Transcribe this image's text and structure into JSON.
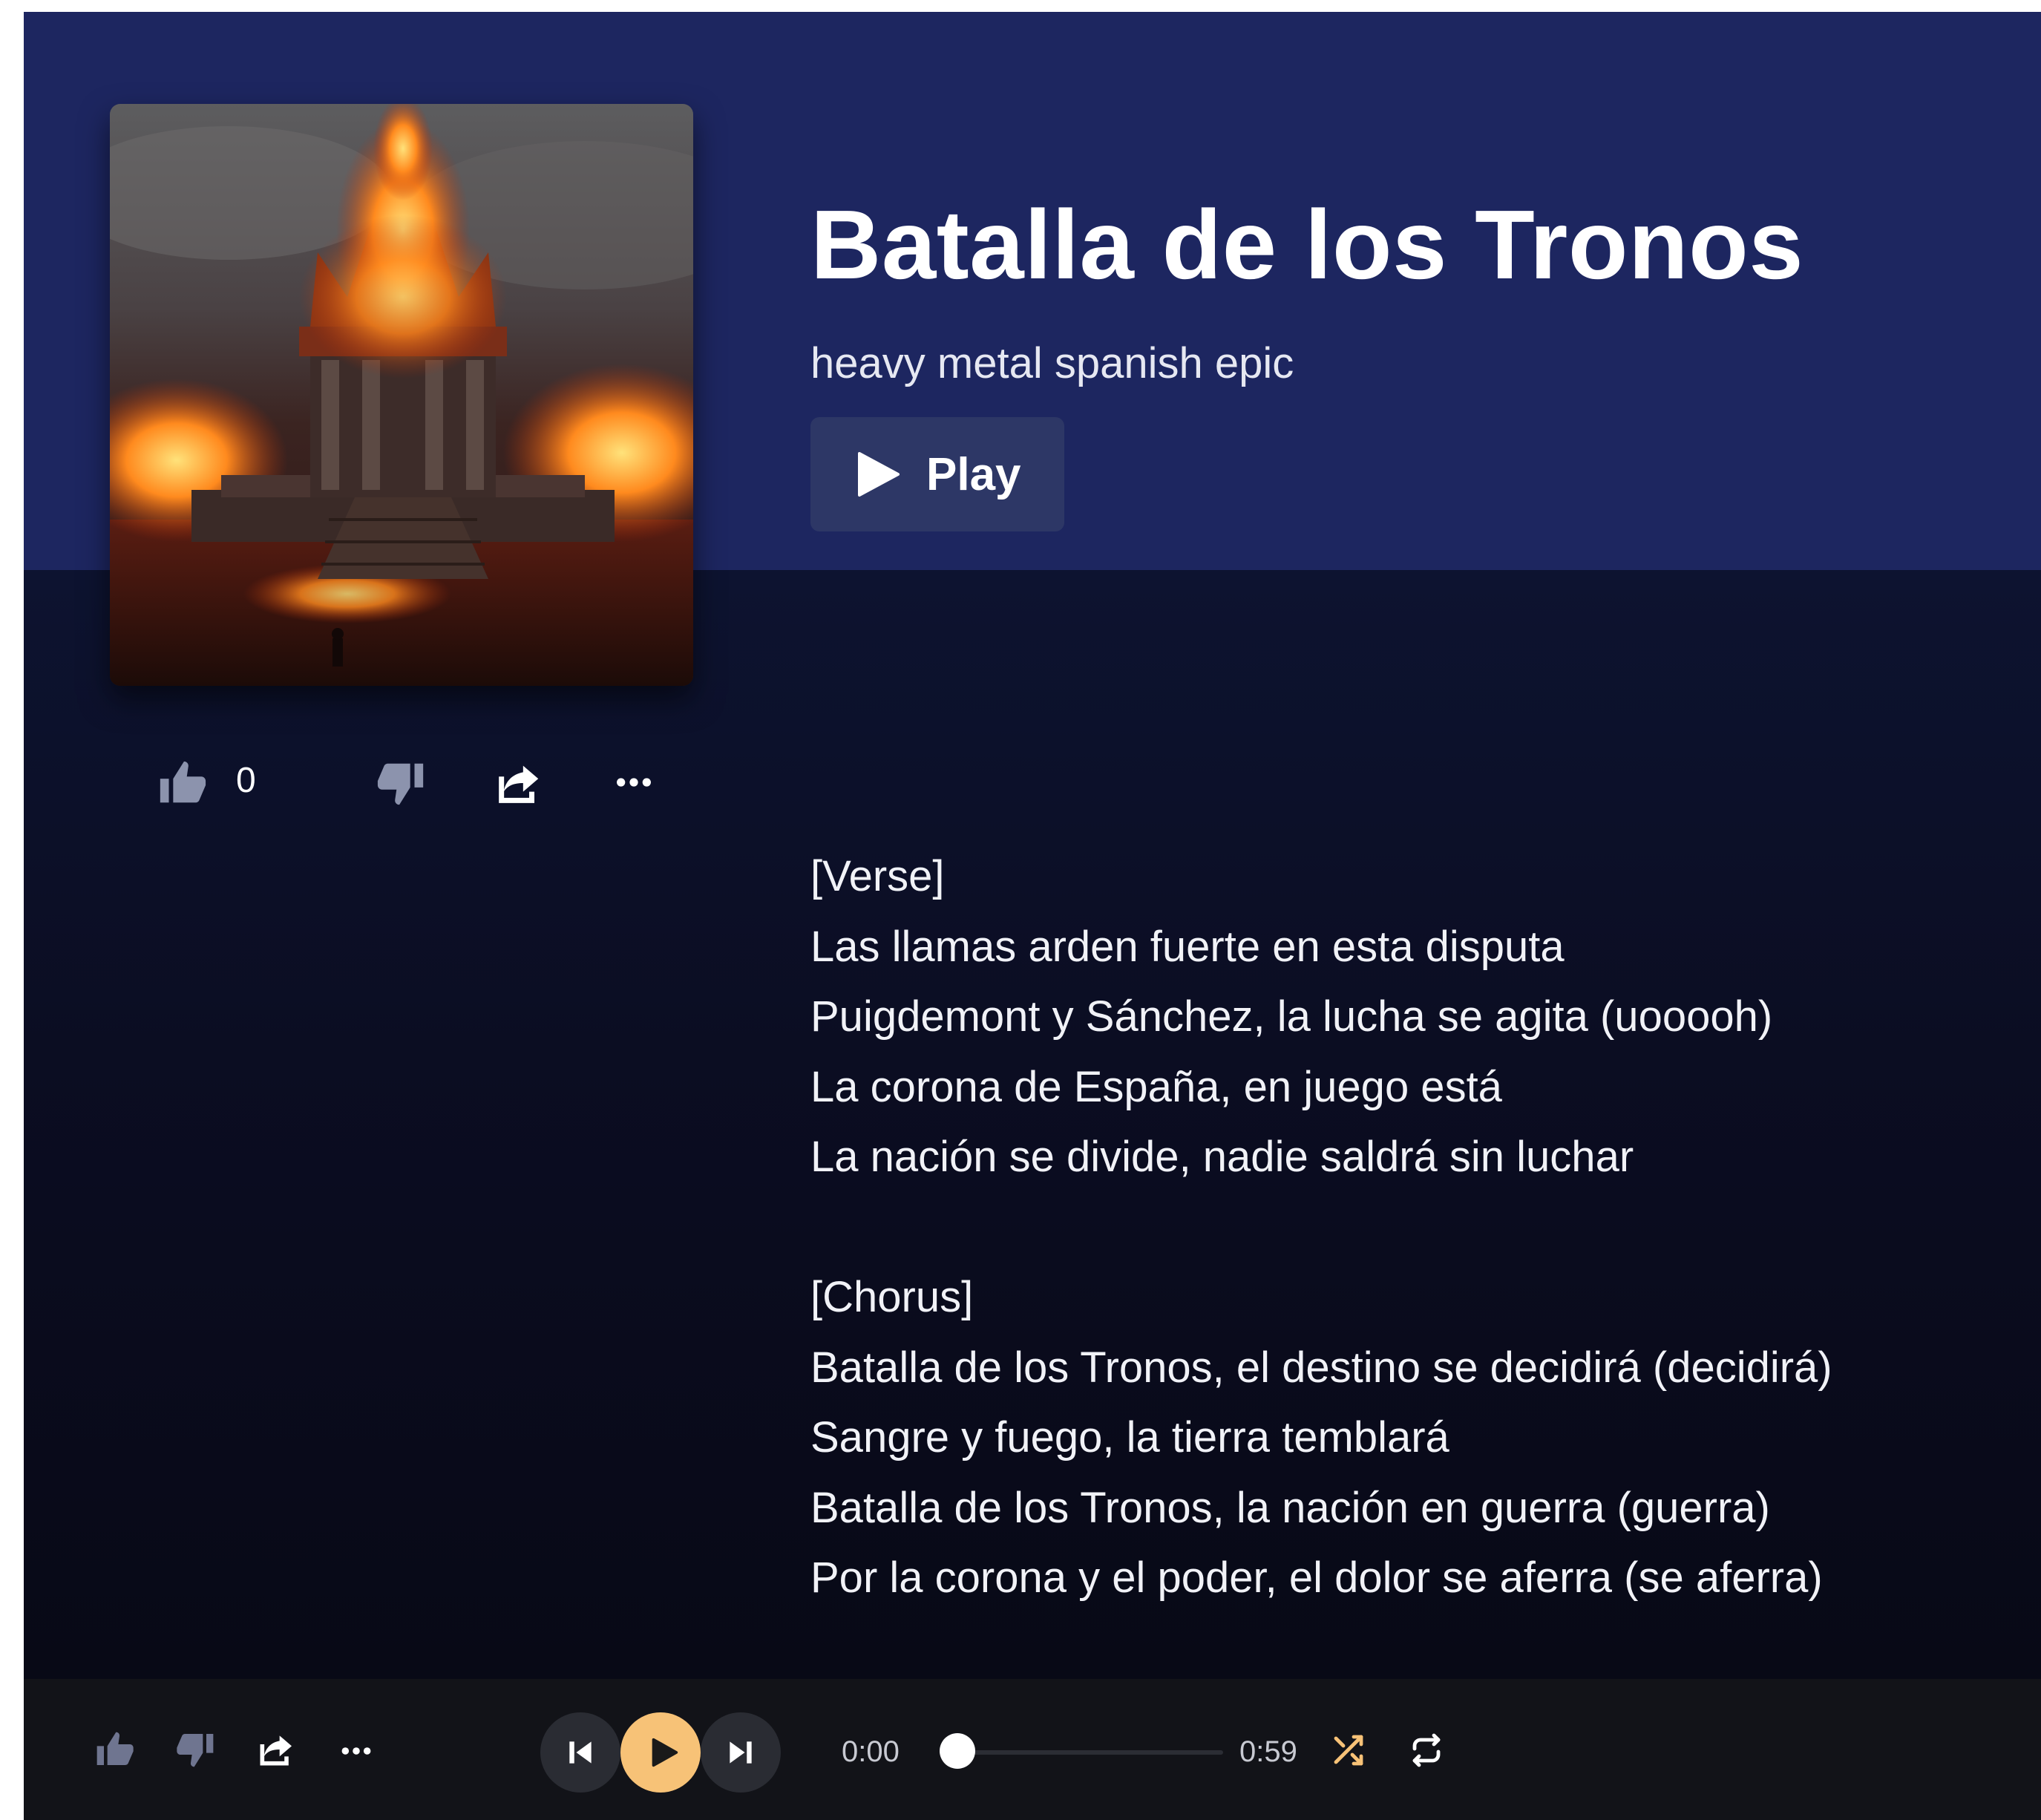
{
  "song": {
    "title": "Batalla de los Tronos",
    "tags": "heavy metal spanish epic",
    "play_label": "Play",
    "like_count": "0"
  },
  "lyrics": {
    "verse": [
      "[Verse]",
      "Las llamas arden fuerte en esta disputa",
      "Puigdemont y Sánchez, la lucha se agita (uooooh)",
      "La corona de España, en juego está",
      "La nación se divide, nadie saldrá sin luchar"
    ],
    "chorus": [
      "[Chorus]",
      "Batalla de los Tronos, el destino se decidirá (decidirá)",
      "Sangre y fuego, la tierra temblará",
      "Batalla de los Tronos, la nación en guerra (guerra)",
      "Por la corona y el poder, el dolor se aferra (se aferra)"
    ]
  },
  "player": {
    "current_time": "0:00",
    "duration": "0:59",
    "progress": 0.0
  },
  "icons": {
    "like": "thumbs-up-icon",
    "dislike": "thumbs-down-icon",
    "share": "share-icon",
    "more": "more-horizontal-icon",
    "previous": "skip-previous-icon",
    "play": "play-icon",
    "next": "skip-next-icon",
    "shuffle": "shuffle-icon",
    "repeat": "repeat-icon"
  },
  "colors": {
    "hero_background": "#1d2660",
    "page_background": "#0b0d22",
    "play_button": "#2d3766",
    "accent": "#f7c277",
    "player_bar": "#121318"
  }
}
